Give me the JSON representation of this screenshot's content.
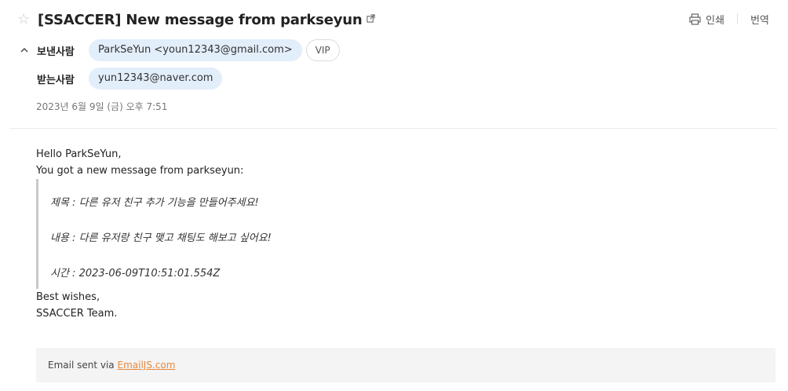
{
  "header": {
    "subject": "[SSACCER] New message from parkseyun",
    "actions": {
      "print": "인쇄",
      "translate": "번역"
    }
  },
  "sender": {
    "label": "보낸사람",
    "address": "ParkSeYun <youn12343@gmail.com>",
    "badge": "VIP"
  },
  "recipient": {
    "label": "받는사람",
    "address": "yun12343@naver.com"
  },
  "date": "2023년 6월 9일 (금) 오후 7:51",
  "body": {
    "greeting": "Hello ParkSeYun,",
    "intro": "You got a new message from parkseyun:",
    "quote": {
      "title": "제목 : 다른 유저 친구 추가 기능을 만들어주세요!",
      "content": "내용 : 다른 유저랑 친구 맺고 채팅도 해보고 싶어요!",
      "time": "시간 : 2023-06-09T10:51:01.554Z"
    },
    "closing": "Best wishes,",
    "signature": "SSACCER Team."
  },
  "footer": {
    "prefix": "Email sent via ",
    "link": "EmailJS.com"
  },
  "colors": {
    "pill_bg": "#e3eefb",
    "link": "#e8883a",
    "quote_bar": "#c9c9c9"
  },
  "icons": [
    "star-icon",
    "external-link-icon",
    "print-icon",
    "chevron-up-icon"
  ]
}
